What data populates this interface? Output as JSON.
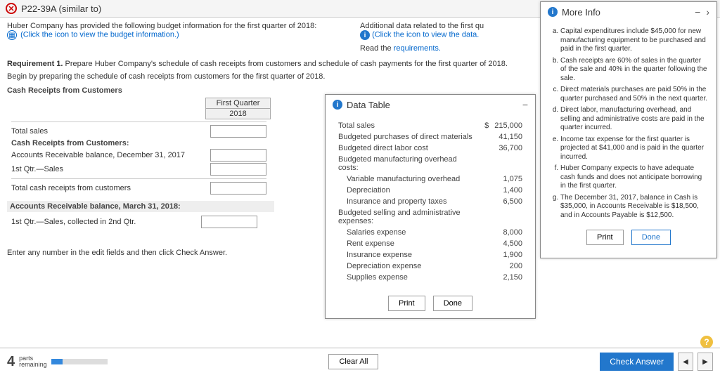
{
  "title": "P22-39A (similar to)",
  "intro": {
    "left_text": "Huber Company has provided the following budget information for the first quarter of 2018:",
    "left_link": "(Click the icon to view the budget information.)",
    "right_text": "Additional data related to the first qu",
    "right_link": "(Click the icon to view the data.",
    "read_text": "Read the ",
    "requirements_link": "requirements."
  },
  "req1_label": "Requirement 1.",
  "req1_text": " Prepare Huber Company's schedule of cash receipts from customers and schedule of cash payments for the first quarter of 2018.",
  "req1_begin": "Begin by preparing the schedule of cash receipts from customers for the first quarter of 2018.",
  "sections": {
    "cash_receipts_heading": "Cash Receipts from Customers",
    "col_header1": "First Quarter",
    "col_header2": "2018",
    "row_total_sales": "Total sales",
    "row_receipts_sub": "Cash Receipts from Customers:",
    "row_ar_balance": "Accounts Receivable balance, December 31, 2017",
    "row_1st_qtr": "1st Qtr.—Sales",
    "row_total_cash_receipts": "Total cash receipts from customers",
    "ar_march_heading": "Accounts Receivable balance, March 31, 2018:",
    "row_collected_2nd": "1st Qtr.—Sales, collected in 2nd Qtr."
  },
  "data_table": {
    "title": "Data Table",
    "rows": [
      {
        "label": "Total sales",
        "prefix": "$",
        "value": "215,000",
        "indent": 0
      },
      {
        "label": "Budgeted purchases of direct materials",
        "value": "41,150",
        "indent": 0
      },
      {
        "label": "Budgeted direct labor cost",
        "value": "36,700",
        "indent": 0
      },
      {
        "label": "Budgeted manufacturing overhead costs:",
        "value": "",
        "indent": 0
      },
      {
        "label": "Variable manufacturing overhead",
        "value": "1,075",
        "indent": 1
      },
      {
        "label": "Depreciation",
        "value": "1,400",
        "indent": 1
      },
      {
        "label": "Insurance and property taxes",
        "value": "6,500",
        "indent": 1
      },
      {
        "label": "Budgeted selling and administrative expenses:",
        "value": "",
        "indent": 0
      },
      {
        "label": "Salaries expense",
        "value": "8,000",
        "indent": 1
      },
      {
        "label": "Rent expense",
        "value": "4,500",
        "indent": 1
      },
      {
        "label": "Insurance expense",
        "value": "1,900",
        "indent": 1
      },
      {
        "label": "Depreciation expense",
        "value": "200",
        "indent": 1
      },
      {
        "label": "Supplies expense",
        "value": "2,150",
        "indent": 1
      }
    ],
    "print": "Print",
    "done": "Done"
  },
  "more_info": {
    "title": "More Info",
    "items": [
      "Capital expenditures include $45,000 for new manufacturing equipment to be purchased and paid in the first quarter.",
      "Cash receipts are 60% of sales in the quarter of the sale and 40% in the quarter following the sale.",
      "Direct materials purchases are paid 50% in the quarter purchased and 50% in the next quarter.",
      "Direct labor, manufacturing overhead, and selling and administrative costs are paid in the quarter incurred.",
      "Income tax expense for the first quarter is projected at $41,000 and is paid in the quarter incurred.",
      "Huber Company expects to have adequate cash funds and does not anticipate borrowing in the first quarter.",
      "The December 31, 2017, balance in Cash is $35,000, in Accounts Receivable is $18,500, and in Accounts Payable is $12,500."
    ],
    "print": "Print",
    "done": "Done"
  },
  "instruction": "Enter any number in the edit fields and then click Check Answer.",
  "footer": {
    "parts_num": "4",
    "parts_label1": "parts",
    "parts_label2": "remaining",
    "clear_all": "Clear All",
    "check": "Check Answer"
  }
}
